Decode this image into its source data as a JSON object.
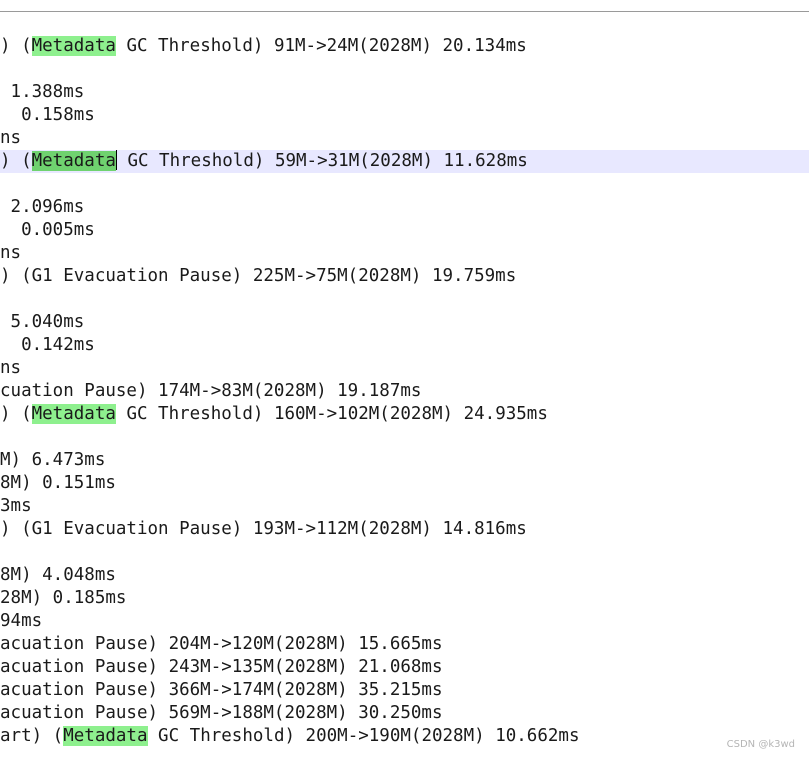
{
  "editor": {
    "current_line_color": "#e8e8ff",
    "highlight_color": "#8ef08e",
    "lines": [
      {
        "pre": ") (",
        "hl": "Metadata",
        "post": " GC Threshold) 91M->24M(2028M) 20.134ms"
      },
      {
        "pre": "",
        "hl": "",
        "post": ""
      },
      {
        "pre": " 1.388ms",
        "hl": "",
        "post": ""
      },
      {
        "pre": "  0.158ms",
        "hl": "",
        "post": ""
      },
      {
        "pre": "ns",
        "hl": "",
        "post": ""
      },
      {
        "pre": ") (",
        "hl": "Metadata",
        "post": " GC Threshold) 59M->31M(2028M) 11.628ms",
        "current": true
      },
      {
        "pre": "",
        "hl": "",
        "post": ""
      },
      {
        "pre": " 2.096ms",
        "hl": "",
        "post": ""
      },
      {
        "pre": "  0.005ms",
        "hl": "",
        "post": ""
      },
      {
        "pre": "ns",
        "hl": "",
        "post": ""
      },
      {
        "pre": ") (G1 Evacuation Pause) 225M->75M(2028M) 19.759ms",
        "hl": "",
        "post": ""
      },
      {
        "pre": "",
        "hl": "",
        "post": ""
      },
      {
        "pre": " 5.040ms",
        "hl": "",
        "post": ""
      },
      {
        "pre": "  0.142ms",
        "hl": "",
        "post": ""
      },
      {
        "pre": "ns",
        "hl": "",
        "post": ""
      },
      {
        "pre": "cuation Pause) 174M->83M(2028M) 19.187ms",
        "hl": "",
        "post": ""
      },
      {
        "pre": ") (",
        "hl": "Metadata",
        "post": " GC Threshold) 160M->102M(2028M) 24.935ms"
      },
      {
        "pre": "",
        "hl": "",
        "post": ""
      },
      {
        "pre": "M) 6.473ms",
        "hl": "",
        "post": ""
      },
      {
        "pre": "8M) 0.151ms",
        "hl": "",
        "post": ""
      },
      {
        "pre": "3ms",
        "hl": "",
        "post": ""
      },
      {
        "pre": ") (G1 Evacuation Pause) 193M->112M(2028M) 14.816ms",
        "hl": "",
        "post": ""
      },
      {
        "pre": "",
        "hl": "",
        "post": ""
      },
      {
        "pre": "8M) 4.048ms",
        "hl": "",
        "post": ""
      },
      {
        "pre": "28M) 0.185ms",
        "hl": "",
        "post": ""
      },
      {
        "pre": "94ms",
        "hl": "",
        "post": ""
      },
      {
        "pre": "acuation Pause) 204M->120M(2028M) 15.665ms",
        "hl": "",
        "post": ""
      },
      {
        "pre": "acuation Pause) 243M->135M(2028M) 21.068ms",
        "hl": "",
        "post": ""
      },
      {
        "pre": "acuation Pause) 366M->174M(2028M) 35.215ms",
        "hl": "",
        "post": ""
      },
      {
        "pre": "acuation Pause) 569M->188M(2028M) 30.250ms",
        "hl": "",
        "post": ""
      },
      {
        "pre": "art) (",
        "hl": "Metadata",
        "post": " GC Threshold) 200M->190M(2028M) 10.662ms"
      }
    ]
  },
  "watermark": "CSDN @k3wd"
}
